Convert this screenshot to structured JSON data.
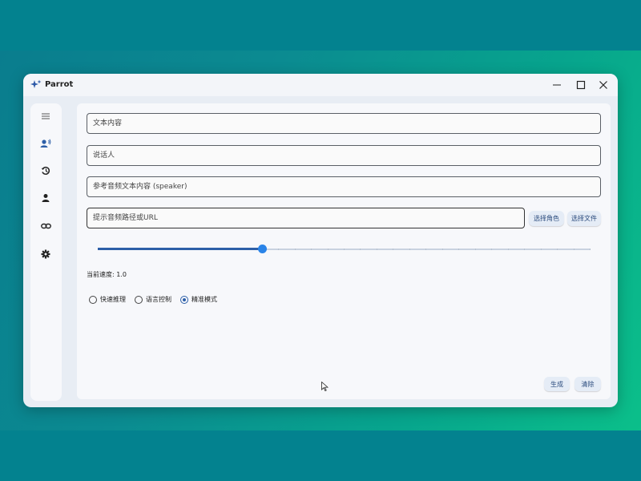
{
  "window": {
    "title": "Parrot"
  },
  "sidebar": {
    "items": [
      {
        "icon": "menu-icon"
      },
      {
        "icon": "voice-user-icon"
      },
      {
        "icon": "history-icon"
      },
      {
        "icon": "person-icon"
      },
      {
        "icon": "link-icon"
      },
      {
        "icon": "settings-gear-icon"
      }
    ]
  },
  "form": {
    "text_placeholder": "文本内容",
    "speaker_placeholder": "说话人",
    "ref_text_placeholder": "参考音频文本内容 (speaker)",
    "audio_path_placeholder": "提示音频路径或URL",
    "select_role_label": "选择角色",
    "select_file_label": "选择文件"
  },
  "speed": {
    "label": "当前速度: 1.0",
    "value": 1.0,
    "min": 0,
    "max": 3,
    "steps": 30
  },
  "modes": {
    "options": [
      "快速推理",
      "语言控制",
      "精准模式"
    ],
    "selected": "精准模式"
  },
  "actions": {
    "generate_label": "生成",
    "clear_label": "清除"
  },
  "colors": {
    "accent": "#2d5fa8",
    "thumb": "#2a84e8",
    "desktop_band": "#03828f",
    "button_bg": "#e5ecf6"
  }
}
